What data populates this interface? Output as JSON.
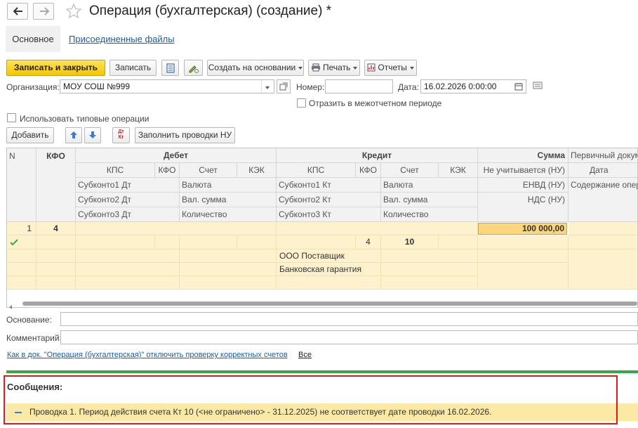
{
  "window": {
    "title": "Операция (бухгалтерская) (создание) *"
  },
  "tabs": {
    "main": "Основное",
    "attachments": "Присоединенные файлы"
  },
  "toolbar": {
    "save_close": "Записать и закрыть",
    "save": "Записать",
    "create_based": "Создать на основании",
    "print": "Печать",
    "reports": "Отчеты"
  },
  "form": {
    "org_label": "Организация:",
    "org_value": "МОУ СОШ №999",
    "number_label": "Номер:",
    "number_value": "",
    "date_label": "Дата:",
    "date_value": "16.02.2026  0:00:00",
    "interperiod_label": "Отразить в межотчетном периоде",
    "typical_ops_label": "Использовать типовые операции"
  },
  "table_toolbar": {
    "add": "Добавить",
    "fill_nu": "Заполнить проводки НУ",
    "dt_kt_icon_text": "Дт Кт"
  },
  "table": {
    "headers": {
      "n": "N",
      "kfo": "КФО",
      "debit": "Дебет",
      "credit": "Кредит",
      "sum": "Сумма",
      "primary_doc": "Первичный докуме",
      "kps": "КПС",
      "kfo_small": "КФО",
      "account": "Счет",
      "kek": "КЭК",
      "not_counted": "Не учитывается (НУ)",
      "date": "Дата",
      "sub1_dt": "Субконто1 Дт",
      "currency": "Валюта",
      "sub1_kt": "Субконто1 Кт",
      "envd": "ЕНВД (НУ)",
      "content": "Содержание опера",
      "sub2_dt": "Субконто2 Дт",
      "cur_sum": "Вал. сумма",
      "sub2_kt": "Субконто2 Кт",
      "vat": "НДС (НУ)",
      "sub3_dt": "Субконто3 Дт",
      "quantity": "Количество",
      "sub3_kt": "Субконто3 Кт"
    },
    "row": {
      "n": "1",
      "kfo": "4",
      "sum": "100 000,00",
      "kt_kfo": "4",
      "kt_account": "10",
      "kt_sub1": "ООО Поставщик",
      "kt_sub2": "Банковская гарантия"
    }
  },
  "bottom": {
    "basis_label": "Основание:",
    "basis_value": "",
    "comment_label": "Комментарий:",
    "comment_value": "",
    "check_link": "Как в док. \"Операция (бухгалтерская)\" отключить проверку корректных счетов",
    "all_link": "Все"
  },
  "messages": {
    "title": "Сообщения:",
    "item": "Проводка 1. Период действия счета Кт 10 (<не ограничено> - 31.12.2025) не соответствует дате проводки 16.02.2026."
  },
  "colors": {
    "accent_yellow": "#f7c500",
    "highlight": "#e01a1a",
    "row_bg": "#fdf2cd",
    "link": "#1a5fa3"
  }
}
